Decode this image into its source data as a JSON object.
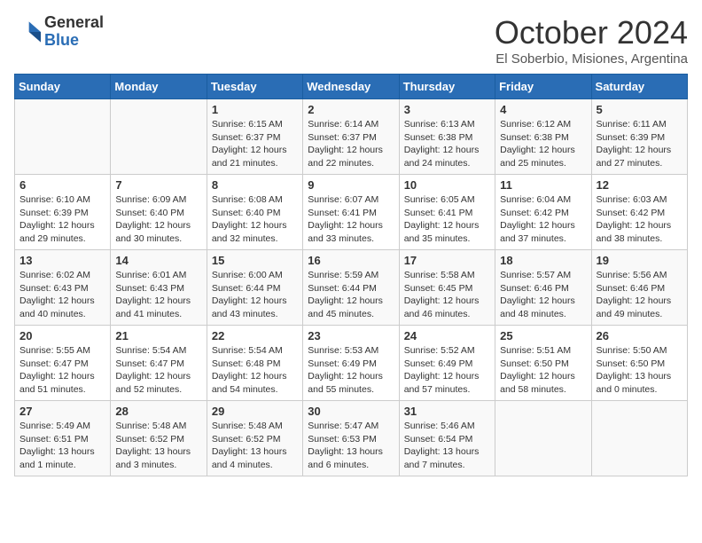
{
  "logo": {
    "general": "General",
    "blue": "Blue"
  },
  "header": {
    "month": "October 2024",
    "location": "El Soberbio, Misiones, Argentina"
  },
  "days_of_week": [
    "Sunday",
    "Monday",
    "Tuesday",
    "Wednesday",
    "Thursday",
    "Friday",
    "Saturday"
  ],
  "weeks": [
    [
      {
        "day": "",
        "info": ""
      },
      {
        "day": "",
        "info": ""
      },
      {
        "day": "1",
        "info": "Sunrise: 6:15 AM\nSunset: 6:37 PM\nDaylight: 12 hours and 21 minutes."
      },
      {
        "day": "2",
        "info": "Sunrise: 6:14 AM\nSunset: 6:37 PM\nDaylight: 12 hours and 22 minutes."
      },
      {
        "day": "3",
        "info": "Sunrise: 6:13 AM\nSunset: 6:38 PM\nDaylight: 12 hours and 24 minutes."
      },
      {
        "day": "4",
        "info": "Sunrise: 6:12 AM\nSunset: 6:38 PM\nDaylight: 12 hours and 25 minutes."
      },
      {
        "day": "5",
        "info": "Sunrise: 6:11 AM\nSunset: 6:39 PM\nDaylight: 12 hours and 27 minutes."
      }
    ],
    [
      {
        "day": "6",
        "info": "Sunrise: 6:10 AM\nSunset: 6:39 PM\nDaylight: 12 hours and 29 minutes."
      },
      {
        "day": "7",
        "info": "Sunrise: 6:09 AM\nSunset: 6:40 PM\nDaylight: 12 hours and 30 minutes."
      },
      {
        "day": "8",
        "info": "Sunrise: 6:08 AM\nSunset: 6:40 PM\nDaylight: 12 hours and 32 minutes."
      },
      {
        "day": "9",
        "info": "Sunrise: 6:07 AM\nSunset: 6:41 PM\nDaylight: 12 hours and 33 minutes."
      },
      {
        "day": "10",
        "info": "Sunrise: 6:05 AM\nSunset: 6:41 PM\nDaylight: 12 hours and 35 minutes."
      },
      {
        "day": "11",
        "info": "Sunrise: 6:04 AM\nSunset: 6:42 PM\nDaylight: 12 hours and 37 minutes."
      },
      {
        "day": "12",
        "info": "Sunrise: 6:03 AM\nSunset: 6:42 PM\nDaylight: 12 hours and 38 minutes."
      }
    ],
    [
      {
        "day": "13",
        "info": "Sunrise: 6:02 AM\nSunset: 6:43 PM\nDaylight: 12 hours and 40 minutes."
      },
      {
        "day": "14",
        "info": "Sunrise: 6:01 AM\nSunset: 6:43 PM\nDaylight: 12 hours and 41 minutes."
      },
      {
        "day": "15",
        "info": "Sunrise: 6:00 AM\nSunset: 6:44 PM\nDaylight: 12 hours and 43 minutes."
      },
      {
        "day": "16",
        "info": "Sunrise: 5:59 AM\nSunset: 6:44 PM\nDaylight: 12 hours and 45 minutes."
      },
      {
        "day": "17",
        "info": "Sunrise: 5:58 AM\nSunset: 6:45 PM\nDaylight: 12 hours and 46 minutes."
      },
      {
        "day": "18",
        "info": "Sunrise: 5:57 AM\nSunset: 6:46 PM\nDaylight: 12 hours and 48 minutes."
      },
      {
        "day": "19",
        "info": "Sunrise: 5:56 AM\nSunset: 6:46 PM\nDaylight: 12 hours and 49 minutes."
      }
    ],
    [
      {
        "day": "20",
        "info": "Sunrise: 5:55 AM\nSunset: 6:47 PM\nDaylight: 12 hours and 51 minutes."
      },
      {
        "day": "21",
        "info": "Sunrise: 5:54 AM\nSunset: 6:47 PM\nDaylight: 12 hours and 52 minutes."
      },
      {
        "day": "22",
        "info": "Sunrise: 5:54 AM\nSunset: 6:48 PM\nDaylight: 12 hours and 54 minutes."
      },
      {
        "day": "23",
        "info": "Sunrise: 5:53 AM\nSunset: 6:49 PM\nDaylight: 12 hours and 55 minutes."
      },
      {
        "day": "24",
        "info": "Sunrise: 5:52 AM\nSunset: 6:49 PM\nDaylight: 12 hours and 57 minutes."
      },
      {
        "day": "25",
        "info": "Sunrise: 5:51 AM\nSunset: 6:50 PM\nDaylight: 12 hours and 58 minutes."
      },
      {
        "day": "26",
        "info": "Sunrise: 5:50 AM\nSunset: 6:50 PM\nDaylight: 13 hours and 0 minutes."
      }
    ],
    [
      {
        "day": "27",
        "info": "Sunrise: 5:49 AM\nSunset: 6:51 PM\nDaylight: 13 hours and 1 minute."
      },
      {
        "day": "28",
        "info": "Sunrise: 5:48 AM\nSunset: 6:52 PM\nDaylight: 13 hours and 3 minutes."
      },
      {
        "day": "29",
        "info": "Sunrise: 5:48 AM\nSunset: 6:52 PM\nDaylight: 13 hours and 4 minutes."
      },
      {
        "day": "30",
        "info": "Sunrise: 5:47 AM\nSunset: 6:53 PM\nDaylight: 13 hours and 6 minutes."
      },
      {
        "day": "31",
        "info": "Sunrise: 5:46 AM\nSunset: 6:54 PM\nDaylight: 13 hours and 7 minutes."
      },
      {
        "day": "",
        "info": ""
      },
      {
        "day": "",
        "info": ""
      }
    ]
  ],
  "colors": {
    "header_bg": "#2a6db5",
    "header_text": "#ffffff",
    "border": "#cccccc"
  }
}
